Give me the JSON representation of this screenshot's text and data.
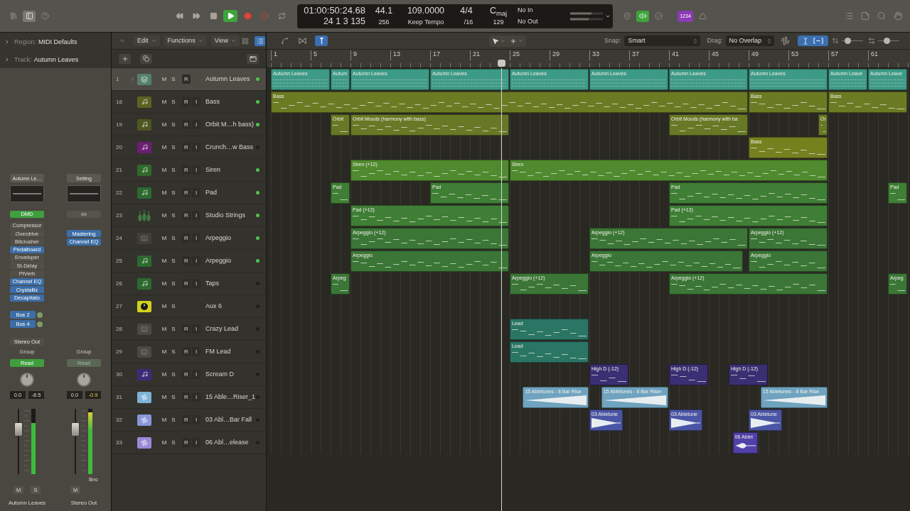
{
  "control_bar": {
    "view_buttons": [
      {
        "kind": "library",
        "on": false
      },
      {
        "kind": "inspector",
        "on": true
      },
      {
        "kind": "help",
        "on": false
      }
    ],
    "transport": [
      {
        "kind": "rewind",
        "on": false
      },
      {
        "kind": "forward",
        "on": false
      },
      {
        "kind": "stop",
        "on": false
      },
      {
        "kind": "play",
        "on": true
      },
      {
        "kind": "record",
        "on": false
      },
      {
        "kind": "capture",
        "on": false
      },
      {
        "kind": "cycle",
        "on": false
      }
    ],
    "lcd": {
      "timecode": "01:00:50:24.68",
      "bars": "24 1 3 135",
      "sample_rate": "44.1",
      "buffer": "256",
      "tempo": "109.0000",
      "tempo_mode": "Keep Tempo",
      "signature": "4/4",
      "division": "/16",
      "key": "C$_{maj}$",
      "key_value": "129",
      "midi_in": "No In",
      "midi_out": "No Out"
    },
    "mode_buttons": [
      {
        "kind": "shield",
        "on": false
      },
      {
        "kind": "speaker",
        "on": true
      },
      {
        "kind": "check",
        "on": false
      },
      {
        "kind": "count_in",
        "label": "1234",
        "on": true
      },
      {
        "kind": "metronome",
        "on": false
      }
    ]
  },
  "inspector": {
    "sections": [
      {
        "label": "Region:",
        "value": "MIDI Defaults",
        "expanded": false
      },
      {
        "label": "Track:",
        "value": "Autumn Leaves",
        "expanded": false
      }
    ],
    "strips": [
      {
        "kind": "channel",
        "setting": "Autumn Le…",
        "slot": "DMD",
        "plugins": [
          {
            "label": "Compressor",
            "active": false
          },
          {
            "label": "Overdrive",
            "active": false
          },
          {
            "label": "Bitcrusher",
            "active": false
          },
          {
            "label": "Pedalboard",
            "active": true
          },
          {
            "label": "Enveloper",
            "active": false
          },
          {
            "label": "St-Delay",
            "active": false
          },
          {
            "label": "PtVerb",
            "active": false
          },
          {
            "label": "Channel EQ",
            "active": true
          },
          {
            "label": "Crystalliz",
            "active": true
          },
          {
            "label": "Decapitato",
            "active": true
          }
        ],
        "sends": [
          {
            "label": "Bus 2"
          },
          {
            "label": "Bus 4"
          }
        ],
        "output": "Stereo Out",
        "group": "Group",
        "automation": {
          "label": "Read",
          "on": true
        },
        "volume": "0.0",
        "peak": {
          "label": "-8.5",
          "hot": false
        },
        "fader": {
          "level": 0.74
        },
        "meter": {
          "level": 0.78
        },
        "buttons": [
          "M",
          "S"
        ],
        "name": "Autumn Leaves"
      },
      {
        "kind": "output",
        "setting": "Setting",
        "plugins": [
          {
            "label": "Mastering",
            "active": true
          },
          {
            "label": "Channel EQ",
            "active": true
          }
        ],
        "group": "Group",
        "automation": {
          "label": "Read",
          "on": false
        },
        "volume": "0.0",
        "peak": {
          "label": "-0.9",
          "hot": true
        },
        "fader": {
          "level": 0.74
        },
        "meter": {
          "level": 0.95
        },
        "bounce": "Bnc",
        "buttons": [
          "M"
        ],
        "name": "Stereo Out"
      }
    ]
  },
  "track_list": {
    "menus": [
      {
        "label": "Edit"
      },
      {
        "label": "Functions"
      },
      {
        "label": "View"
      }
    ],
    "view_toggles": [
      {
        "kind": "grid",
        "on": false
      },
      {
        "kind": "list",
        "on": true
      }
    ]
  },
  "arrange": {
    "tools": [
      {
        "kind": "automation",
        "on": false
      },
      {
        "kind": "flex",
        "on": false
      },
      {
        "kind": "catch",
        "on": true
      }
    ],
    "snap": {
      "label": "Snap:",
      "value": "Smart"
    },
    "drag": {
      "label": "Drag:",
      "value": "No Overlap"
    },
    "zoom_toggle": {
      "on": true
    },
    "zoom_sliders": [
      {
        "level": 0.2
      },
      {
        "level": 0.4
      }
    ],
    "ruler": [
      "1",
      "5",
      "9",
      "13",
      "17",
      "21",
      "25",
      "29",
      "33",
      "37",
      "41",
      "45",
      "49",
      "53",
      "57",
      "61"
    ]
  },
  "tracks": [
    {
      "number": "1",
      "name": "Autumn Leaves",
      "kind": "stack",
      "color": "#56806e",
      "selected": true,
      "on": true,
      "buttons": [
        "M",
        "S",
        "R"
      ],
      "regions": [
        {
          "name": "Autumn Leaves",
          "color": "#3d9a86"
        },
        {
          "name": "Autum",
          "color": "#3d9a86"
        },
        {
          "name": "Autumn Leaves",
          "color": "#3d9a86"
        },
        {
          "name": "Autumn Leaves",
          "color": "#3d9a86"
        },
        {
          "name": "Autumn Leaves",
          "color": "#3d9a86"
        },
        {
          "name": "Autumn Leaves",
          "color": "#3d9a86"
        },
        {
          "name": "Autumn Leaves",
          "color": "#3d9a86"
        },
        {
          "name": "Autumn Leaves",
          "color": "#3d9a86"
        },
        {
          "name": "Autumn Leave",
          "color": "#3d9a86"
        },
        {
          "name": "Autumn Leave",
          "color": "#3d9a86"
        }
      ]
    },
    {
      "number": "18",
      "name": "Bass",
      "kind": "midi",
      "color": "#5a6420",
      "selected": false,
      "on": true,
      "buttons": [
        "M",
        "S",
        "R",
        "I"
      ],
      "regions": [
        {
          "name": "Bass",
          "color": "#6b7b24"
        },
        {
          "name": "Bass",
          "color": "#6b7b24"
        },
        {
          "name": "Bass",
          "color": "#6b7b24"
        }
      ]
    },
    {
      "number": "19",
      "name": "Orbit M…h bass)",
      "kind": "midi",
      "color": "#4d5720",
      "selected": false,
      "on": true,
      "buttons": [
        "M",
        "S",
        "R",
        "I"
      ],
      "regions": [
        {
          "name": "Orbit",
          "color": "#677826"
        },
        {
          "name": "Orbit Moods (harmony with bass)",
          "color": "#677826"
        },
        {
          "name": "Orbit Moods (harmony with ba",
          "color": "#677826"
        },
        {
          "name": "Or",
          "color": "#677826"
        }
      ]
    },
    {
      "number": "20",
      "name": "Crunch…w Bass",
      "kind": "midi",
      "color": "#6c1f74",
      "selected": false,
      "on": false,
      "buttons": [
        "M",
        "S",
        "R",
        "I"
      ],
      "regions": [
        {
          "name": "Bass",
          "color": "#75801f"
        }
      ]
    },
    {
      "number": "21",
      "name": "Siren",
      "kind": "midi",
      "color": "#2f6a2a",
      "selected": false,
      "on": true,
      "buttons": [
        "M",
        "S",
        "R",
        "I"
      ],
      "regions": [
        {
          "name": "Siren (+12)",
          "color": "#4f8a2e"
        },
        {
          "name": "Siren",
          "color": "#4f8a2e"
        }
      ]
    },
    {
      "number": "22",
      "name": "Pad",
      "kind": "midi",
      "color": "#2c6a30",
      "selected": false,
      "on": true,
      "buttons": [
        "M",
        "S",
        "R",
        "I"
      ],
      "regions": [
        {
          "name": "Pad",
          "color": "#3f7e35"
        },
        {
          "name": "Pad",
          "color": "#3f7e35"
        },
        {
          "name": "Pad",
          "color": "#3f7e35"
        },
        {
          "name": "Pad",
          "color": "#3f7e35"
        }
      ]
    },
    {
      "number": "23",
      "name": "Studio Strings",
      "kind": "strings",
      "color": "#3f7a46",
      "selected": false,
      "on": true,
      "buttons": [
        "M",
        "S",
        "R",
        "I"
      ],
      "regions": [
        {
          "name": "Pad (+12)",
          "color": "#3f7e35"
        },
        {
          "name": "Pad (+12)",
          "color": "#3f7e35"
        }
      ]
    },
    {
      "number": "24",
      "name": "Arpeggio",
      "kind": "synth",
      "color": "#3f3e38",
      "selected": false,
      "on": true,
      "buttons": [
        "M",
        "S",
        "R",
        "I"
      ],
      "regions": [
        {
          "name": "Arpeggio (+12)",
          "color": "#3b7636"
        },
        {
          "name": "Arpeggio (+12)",
          "color": "#3b7636"
        },
        {
          "name": "Arpeggio (+12)",
          "color": "#3b7636"
        }
      ]
    },
    {
      "number": "25",
      "name": "Arpeggio",
      "kind": "midi",
      "color": "#2c6a30",
      "selected": false,
      "on": true,
      "buttons": [
        "M",
        "S",
        "R",
        "I"
      ],
      "regions": [
        {
          "name": "Arpeggio",
          "color": "#3b7636"
        },
        {
          "name": "Arpeggio",
          "color": "#3b7636"
        },
        {
          "name": "Arpeggio",
          "color": "#3b7636"
        }
      ]
    },
    {
      "number": "26",
      "name": "Taps",
      "kind": "midi",
      "color": "#2c6a30",
      "selected": false,
      "on": false,
      "buttons": [
        "M",
        "S",
        "R",
        "I"
      ],
      "regions": [
        {
          "name": "Arpeg",
          "color": "#3b7636"
        },
        {
          "name": "Arpeggio (+12)",
          "color": "#3b7636"
        },
        {
          "name": "Arpeggio (+12)",
          "color": "#3b7636"
        },
        {
          "name": "Arpeg",
          "color": "#3b7636"
        }
      ]
    },
    {
      "number": "27",
      "name": "Aux 6",
      "kind": "aux",
      "color": "#d2d21c",
      "selected": false,
      "on": false,
      "buttons": [
        "M",
        "S"
      ]
    },
    {
      "number": "28",
      "name": "Crazy Lead",
      "kind": "synth",
      "color": "#4a4943",
      "selected": false,
      "on": false,
      "buttons": [
        "M",
        "S",
        "R",
        "I"
      ],
      "regions": [
        {
          "name": "Lead",
          "color": "#2a7564"
        }
      ]
    },
    {
      "number": "29",
      "name": "FM Lead",
      "kind": "synth",
      "color": "#4a4943",
      "selected": false,
      "on": false,
      "buttons": [
        "M",
        "S",
        "R",
        "I"
      ],
      "regions": [
        {
          "name": "Lead",
          "color": "#2a7564"
        }
      ]
    },
    {
      "number": "30",
      "name": "Scream D",
      "kind": "midi",
      "color": "#3b2c7a",
      "selected": false,
      "on": false,
      "buttons": [
        "M",
        "S",
        "R",
        "I"
      ],
      "regions": [
        {
          "name": "High D (-12)",
          "color": "#3a2f72"
        },
        {
          "name": "High D (-12)",
          "color": "#3a2f72"
        },
        {
          "name": "High D (-12)",
          "color": "#3a2f72"
        }
      ]
    },
    {
      "number": "31",
      "name": "15 Able…Riser_1",
      "kind": "audio",
      "color": "#7db3d6",
      "selected": false,
      "on": false,
      "buttons": [
        "M",
        "S",
        "R",
        "I"
      ],
      "regions": [
        {
          "name": "15 Abletunes - 8 Bar Rise",
          "color": "#6fa3bf"
        },
        {
          "name": "15 Abletunes - 8 Bar Riser",
          "color": "#6fa3bf"
        },
        {
          "name": "15 Abletunes - 8 Bar Rise",
          "color": "#6fa3bf"
        }
      ]
    },
    {
      "number": "32",
      "name": "03 Abl…Bar Fall",
      "kind": "audio",
      "color": "#8a96d8",
      "selected": false,
      "on": false,
      "buttons": [
        "M",
        "S",
        "R",
        "I"
      ],
      "regions": [
        {
          "name": "03 Abletune",
          "color": "#4b55a5"
        },
        {
          "name": "03 Abletune",
          "color": "#4b55a5"
        },
        {
          "name": "03 Abletune",
          "color": "#4b55a5"
        }
      ]
    },
    {
      "number": "33",
      "name": "06 Abl…elease",
      "kind": "audio",
      "color": "#9a8ad8",
      "selected": false,
      "on": false,
      "buttons": [
        "M",
        "S",
        "R",
        "I"
      ],
      "regions": [
        {
          "name": "06 Ablet",
          "color": "#5040a8"
        }
      ]
    }
  ]
}
